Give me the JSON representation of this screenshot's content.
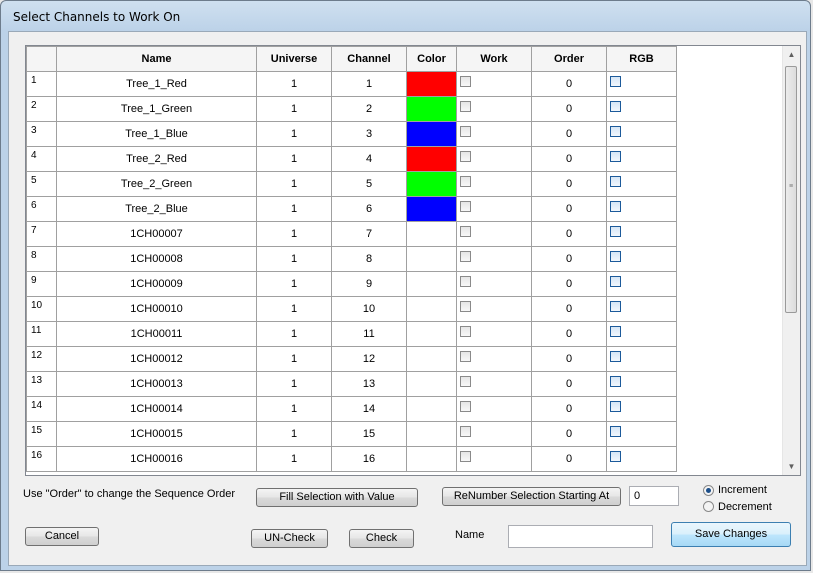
{
  "window": {
    "title": "Select Channels to Work On"
  },
  "table": {
    "columns": [
      "Name",
      "Universe",
      "Channel",
      "Color",
      "Work",
      "Order",
      "RGB"
    ],
    "rows": [
      {
        "num": "1",
        "name": "Tree_1_Red",
        "universe": "1",
        "channel": "1",
        "color": "#ff0000",
        "order": "0"
      },
      {
        "num": "2",
        "name": "Tree_1_Green",
        "universe": "1",
        "channel": "2",
        "color": "#00ff00",
        "order": "0"
      },
      {
        "num": "3",
        "name": "Tree_1_Blue",
        "universe": "1",
        "channel": "3",
        "color": "#0000ff",
        "order": "0"
      },
      {
        "num": "4",
        "name": "Tree_2_Red",
        "universe": "1",
        "channel": "4",
        "color": "#ff0000",
        "order": "0"
      },
      {
        "num": "5",
        "name": "Tree_2_Green",
        "universe": "1",
        "channel": "5",
        "color": "#00ff00",
        "order": "0"
      },
      {
        "num": "6",
        "name": "Tree_2_Blue",
        "universe": "1",
        "channel": "6",
        "color": "#0000ff",
        "order": "0"
      },
      {
        "num": "7",
        "name": "1CH00007",
        "universe": "1",
        "channel": "7",
        "color": "#ffffff",
        "order": "0"
      },
      {
        "num": "8",
        "name": "1CH00008",
        "universe": "1",
        "channel": "8",
        "color": "#ffffff",
        "order": "0"
      },
      {
        "num": "9",
        "name": "1CH00009",
        "universe": "1",
        "channel": "9",
        "color": "#ffffff",
        "order": "0"
      },
      {
        "num": "10",
        "name": "1CH00010",
        "universe": "1",
        "channel": "10",
        "color": "#ffffff",
        "order": "0"
      },
      {
        "num": "11",
        "name": "1CH00011",
        "universe": "1",
        "channel": "11",
        "color": "#ffffff",
        "order": "0"
      },
      {
        "num": "12",
        "name": "1CH00012",
        "universe": "1",
        "channel": "12",
        "color": "#ffffff",
        "order": "0"
      },
      {
        "num": "13",
        "name": "1CH00013",
        "universe": "1",
        "channel": "13",
        "color": "#ffffff",
        "order": "0"
      },
      {
        "num": "14",
        "name": "1CH00014",
        "universe": "1",
        "channel": "14",
        "color": "#ffffff",
        "order": "0"
      },
      {
        "num": "15",
        "name": "1CH00015",
        "universe": "1",
        "channel": "15",
        "color": "#ffffff",
        "order": "0"
      },
      {
        "num": "16",
        "name": "1CH00016",
        "universe": "1",
        "channel": "16",
        "color": "#ffffff",
        "order": "0"
      }
    ]
  },
  "controls": {
    "hint": "Use \"Order\" to change the Sequence Order",
    "fill_button": "Fill Selection with Value",
    "renumber_button": "ReNumber Selection Starting At",
    "start_value": "0",
    "increment_label": "Increment",
    "decrement_label": "Decrement",
    "increment_selected": true,
    "cancel_button": "Cancel",
    "uncheck_button": "UN-Check",
    "check_button": "Check",
    "name_label": "Name",
    "name_value": "",
    "save_button": "Save Changes"
  },
  "icons": {
    "scroll_up": "triangle-up",
    "scroll_down": "triangle-down"
  }
}
